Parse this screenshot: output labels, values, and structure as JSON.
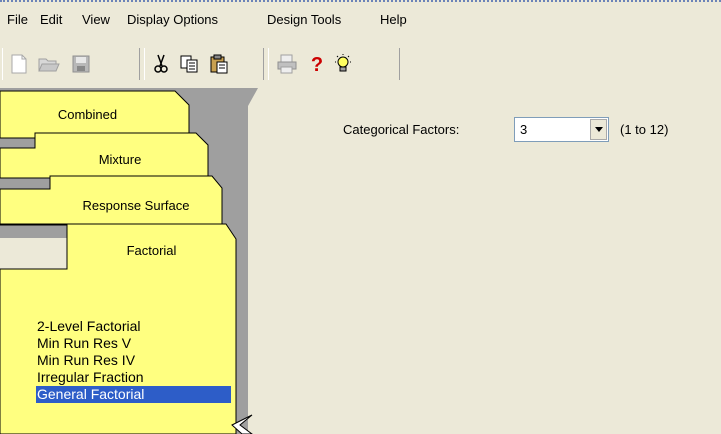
{
  "menu": {
    "items": [
      "File",
      "Edit",
      "View",
      "Display Options",
      "Design Tools",
      "Help"
    ]
  },
  "toolbar": {
    "buttons": [
      "new-document-icon",
      "open-folder-icon",
      "save-icon",
      "cut-icon",
      "copy-icon",
      "paste-icon",
      "print-icon",
      "help-icon",
      "tip-icon"
    ]
  },
  "design_tabs": {
    "combined": "Combined",
    "mixture": "Mixture",
    "response_surface": "Response Surface",
    "factorial": "Factorial"
  },
  "factorial_designs": [
    "2-Level Factorial",
    "Min Run Res V",
    "Min Run Res IV",
    "Irregular Fraction",
    "General Factorial"
  ],
  "selected_design": "General Factorial",
  "categorical_factors": {
    "label": "Categorical Factors:",
    "value": "3",
    "range": "(1 to 12)"
  },
  "colors": {
    "tab_yellow": "#ffff80",
    "selection": "#2d5dc8",
    "window_bg": "#ece9d8",
    "help_red": "#cc0000"
  }
}
